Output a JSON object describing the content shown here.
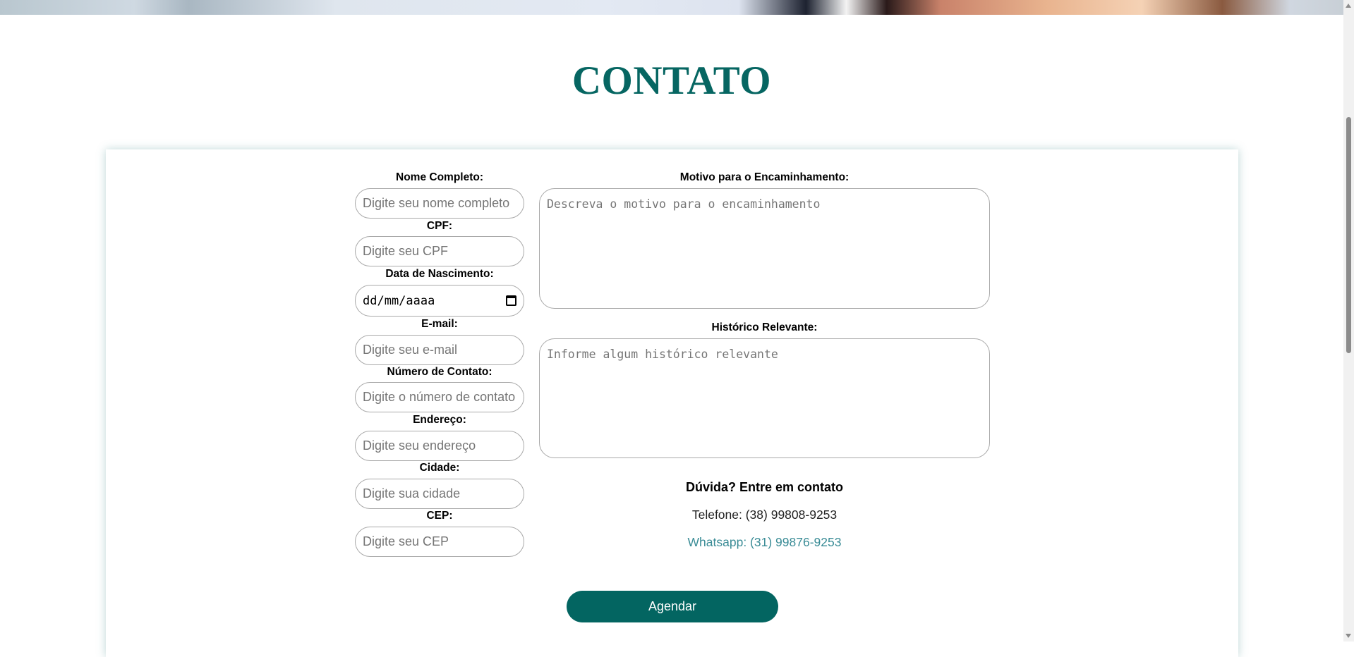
{
  "title": "CONTATO",
  "left_fields": [
    {
      "label": "Nome Completo:",
      "placeholder": "Digite seu nome completo"
    },
    {
      "label": "CPF:",
      "placeholder": "Digite seu CPF"
    },
    {
      "label": "Data de Nascimento:",
      "placeholder": "dd/mm/aaaa"
    },
    {
      "label": "E-mail:",
      "placeholder": "Digite seu e-mail"
    },
    {
      "label": "Número de Contato:",
      "placeholder": "Digite o número de contato"
    },
    {
      "label": "Endereço:",
      "placeholder": "Digite seu endereço"
    },
    {
      "label": "Cidade:",
      "placeholder": "Digite sua cidade"
    },
    {
      "label": "CEP:",
      "placeholder": "Digite seu CEP"
    }
  ],
  "right_fields": [
    {
      "label": "Motivo para o Encaminhamento:",
      "placeholder": "Descreva o motivo para o encaminhamento"
    },
    {
      "label": "Histórico Relevante:",
      "placeholder": "Informe algum histórico relevante"
    }
  ],
  "contact": {
    "heading": "Dúvida? Entre em contato",
    "phone": "Telefone: (38) 99808-9253",
    "whatsapp": "Whatsapp: (31) 99876-9253"
  },
  "submit_label": "Agendar",
  "colors": {
    "accent": "#036561",
    "whatsapp": "#3a8c96"
  }
}
